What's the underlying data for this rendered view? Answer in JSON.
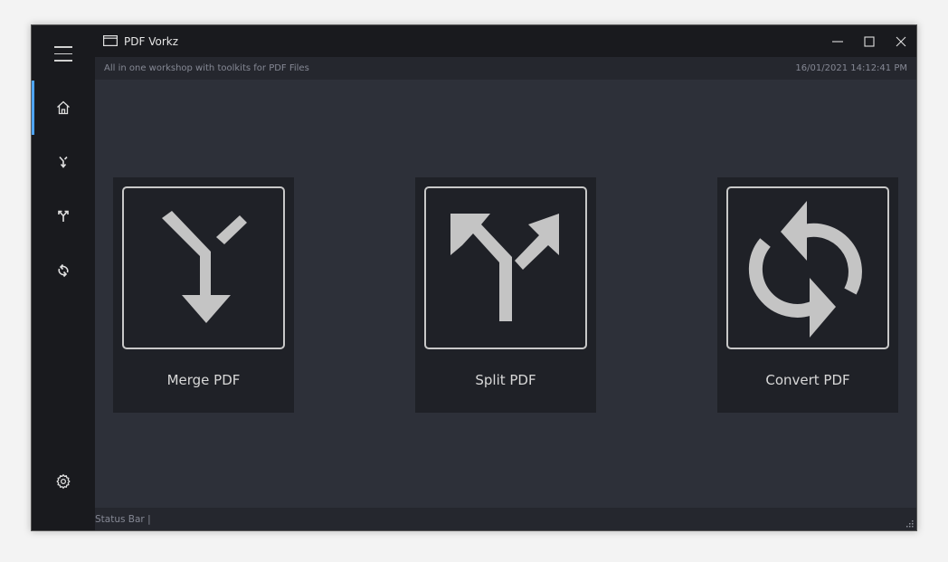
{
  "app": {
    "title": "PDF Vorkz",
    "subtitle": "All in one workshop with toolkits for PDF Files",
    "datetime": "16/01/2021 14:12:41 PM"
  },
  "sidebar": {
    "items": [
      {
        "icon": "home-icon",
        "active": true
      },
      {
        "icon": "merge-icon",
        "active": false
      },
      {
        "icon": "split-icon",
        "active": false
      },
      {
        "icon": "convert-icon",
        "active": false
      },
      {
        "icon": "settings-icon",
        "active": false
      }
    ]
  },
  "tiles": [
    {
      "label": "Merge PDF",
      "icon": "merge-icon"
    },
    {
      "label": "Split PDF",
      "icon": "split-icon"
    },
    {
      "label": "Convert PDF",
      "icon": "convert-icon"
    }
  ],
  "status": {
    "text": "Status Bar |"
  },
  "colors": {
    "accent": "#4ea5f5",
    "sidebar": "#191a1e",
    "content": "#2d3039",
    "tile": "#1f2127"
  }
}
